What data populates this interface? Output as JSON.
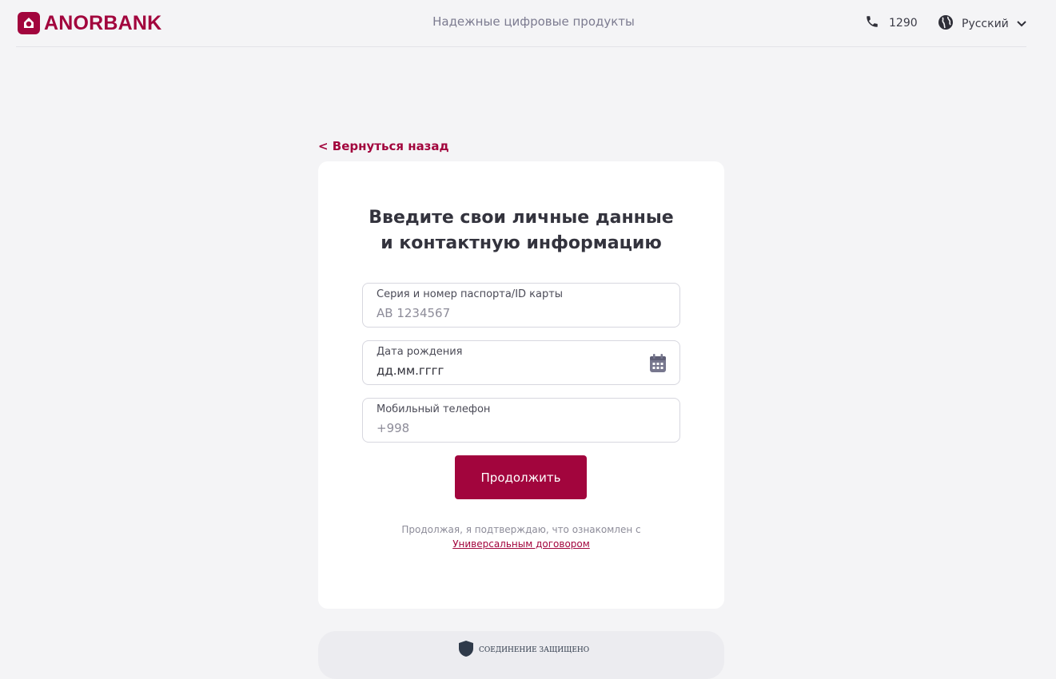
{
  "header": {
    "brand": "ANORBANK",
    "tagline": "Надежные цифровые продукты",
    "phone_icon": "phone-icon",
    "phone_number": "1290",
    "lang_icon": "globe-icon",
    "language": "Русский"
  },
  "back_link": "< Вернуться назад",
  "form": {
    "title_line1": "Введите свои личные данные",
    "title_line2": "и контактную информацию",
    "passport": {
      "label": "Серия и номер паспорта/ID карты",
      "placeholder": "AB 1234567"
    },
    "birth_date": {
      "label": "Дата рождения",
      "value": "дд.мм.гггг"
    },
    "phone": {
      "label": "Мобильный телефон",
      "placeholder": "+998"
    },
    "continue_button": "Продолжить",
    "consent_text": "Продолжая, я подтверждаю, что ознакомлен с",
    "consent_link": "Универсальным договором"
  },
  "security_badge": "Соединение защищено",
  "colors": {
    "brand": "#a2053d",
    "background": "#f4f4f6",
    "card": "#ffffff"
  }
}
